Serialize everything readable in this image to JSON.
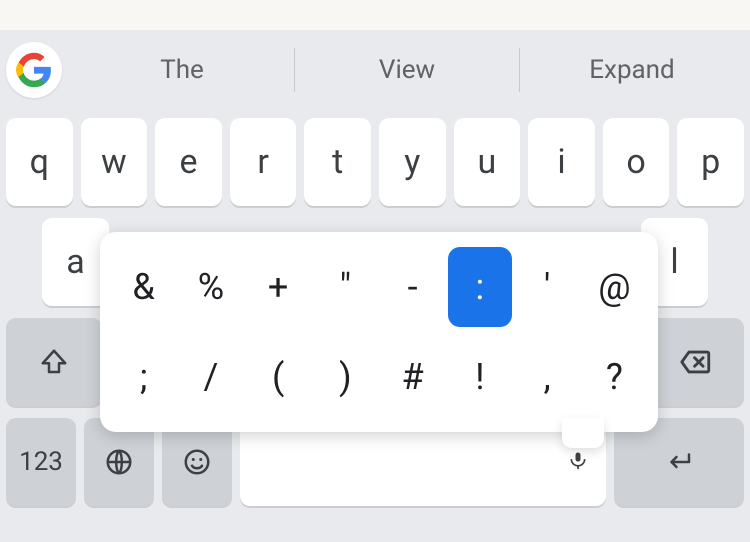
{
  "suggestions": {
    "s1": "The",
    "s2": "View",
    "s3": "Expand"
  },
  "row1": {
    "k0": "q",
    "k1": "w",
    "k2": "e",
    "k3": "r",
    "k4": "t",
    "k5": "y",
    "k6": "u",
    "k7": "i",
    "k8": "o",
    "k9": "p"
  },
  "row2": {
    "k0": "a",
    "k8": "l"
  },
  "symkey": {
    "label": "123"
  },
  "popup": {
    "r1": {
      "c0": "&",
      "c1": "%",
      "c2": "+",
      "c3": "\"",
      "c4": "-",
      "c5": ":",
      "c6": "'",
      "c7": "@"
    },
    "r2": {
      "c0": ";",
      "c1": "/",
      "c2": "(",
      "c3": ")",
      "c4": "#",
      "c5": "!",
      "c6": ",",
      "c7": "?"
    },
    "selected": ":"
  }
}
